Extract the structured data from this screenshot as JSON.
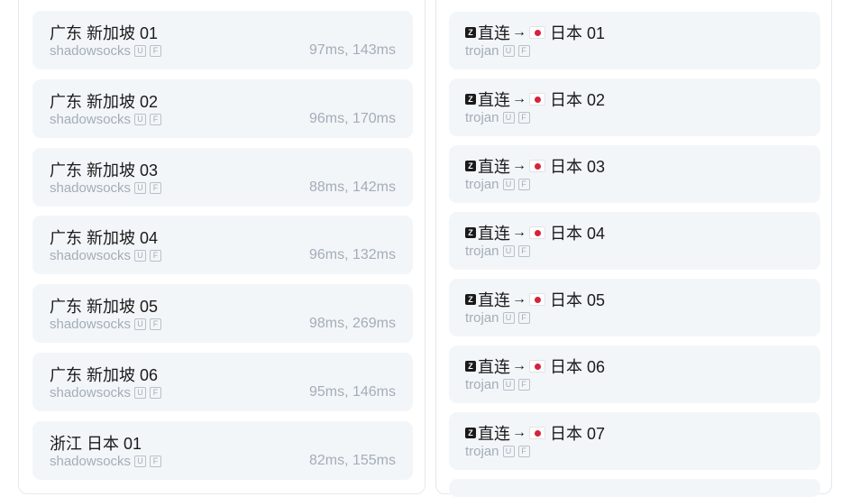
{
  "left_nodes": [
    {
      "name": "广东 新加坡 01",
      "protocol": "shadowsocks",
      "flags": [
        "U",
        "F"
      ],
      "latency": "97ms, 143ms"
    },
    {
      "name": "广东 新加坡 02",
      "protocol": "shadowsocks",
      "flags": [
        "U",
        "F"
      ],
      "latency": "96ms, 170ms"
    },
    {
      "name": "广东 新加坡 03",
      "protocol": "shadowsocks",
      "flags": [
        "U",
        "F"
      ],
      "latency": "88ms, 142ms"
    },
    {
      "name": "广东 新加坡 04",
      "protocol": "shadowsocks",
      "flags": [
        "U",
        "F"
      ],
      "latency": "96ms, 132ms"
    },
    {
      "name": "广东 新加坡 05",
      "protocol": "shadowsocks",
      "flags": [
        "U",
        "F"
      ],
      "latency": "98ms, 269ms"
    },
    {
      "name": "广东 新加坡 06",
      "protocol": "shadowsocks",
      "flags": [
        "U",
        "F"
      ],
      "latency": "95ms, 146ms"
    },
    {
      "name": "浙江 日本 01",
      "protocol": "shadowsocks",
      "flags": [
        "U",
        "F"
      ],
      "latency": "82ms, 155ms"
    }
  ],
  "right_nodes": [
    {
      "prefix": "直连",
      "arrow": "→",
      "region": "日本 01",
      "protocol": "trojan",
      "flags": [
        "U",
        "F"
      ]
    },
    {
      "prefix": "直连",
      "arrow": "→",
      "region": "日本 02",
      "protocol": "trojan",
      "flags": [
        "U",
        "F"
      ]
    },
    {
      "prefix": "直连",
      "arrow": "→",
      "region": "日本 03",
      "protocol": "trojan",
      "flags": [
        "U",
        "F"
      ]
    },
    {
      "prefix": "直连",
      "arrow": "→",
      "region": "日本 04",
      "protocol": "trojan",
      "flags": [
        "U",
        "F"
      ]
    },
    {
      "prefix": "直连",
      "arrow": "→",
      "region": "日本 05",
      "protocol": "trojan",
      "flags": [
        "U",
        "F"
      ]
    },
    {
      "prefix": "直连",
      "arrow": "→",
      "region": "日本 06",
      "protocol": "trojan",
      "flags": [
        "U",
        "F"
      ]
    },
    {
      "prefix": "直连",
      "arrow": "→",
      "region": "日本 07",
      "protocol": "trojan",
      "flags": [
        "U",
        "F"
      ]
    }
  ],
  "icons": {
    "z_badge": "Z",
    "flag": "japan-flag-icon"
  },
  "colors": {
    "card_bg": "#f3f6f9",
    "muted_text": "#a3adb8",
    "title_text": "#1a1a1a"
  }
}
